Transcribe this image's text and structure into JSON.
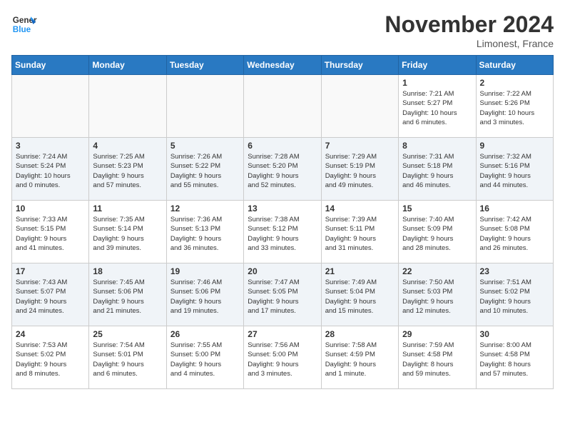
{
  "logo": {
    "line1": "General",
    "line2": "Blue"
  },
  "title": "November 2024",
  "location": "Limonest, France",
  "days_of_week": [
    "Sunday",
    "Monday",
    "Tuesday",
    "Wednesday",
    "Thursday",
    "Friday",
    "Saturday"
  ],
  "weeks": [
    [
      {
        "day": "",
        "info": ""
      },
      {
        "day": "",
        "info": ""
      },
      {
        "day": "",
        "info": ""
      },
      {
        "day": "",
        "info": ""
      },
      {
        "day": "",
        "info": ""
      },
      {
        "day": "1",
        "info": "Sunrise: 7:21 AM\nSunset: 5:27 PM\nDaylight: 10 hours\nand 6 minutes."
      },
      {
        "day": "2",
        "info": "Sunrise: 7:22 AM\nSunset: 5:26 PM\nDaylight: 10 hours\nand 3 minutes."
      }
    ],
    [
      {
        "day": "3",
        "info": "Sunrise: 7:24 AM\nSunset: 5:24 PM\nDaylight: 10 hours\nand 0 minutes."
      },
      {
        "day": "4",
        "info": "Sunrise: 7:25 AM\nSunset: 5:23 PM\nDaylight: 9 hours\nand 57 minutes."
      },
      {
        "day": "5",
        "info": "Sunrise: 7:26 AM\nSunset: 5:22 PM\nDaylight: 9 hours\nand 55 minutes."
      },
      {
        "day": "6",
        "info": "Sunrise: 7:28 AM\nSunset: 5:20 PM\nDaylight: 9 hours\nand 52 minutes."
      },
      {
        "day": "7",
        "info": "Sunrise: 7:29 AM\nSunset: 5:19 PM\nDaylight: 9 hours\nand 49 minutes."
      },
      {
        "day": "8",
        "info": "Sunrise: 7:31 AM\nSunset: 5:18 PM\nDaylight: 9 hours\nand 46 minutes."
      },
      {
        "day": "9",
        "info": "Sunrise: 7:32 AM\nSunset: 5:16 PM\nDaylight: 9 hours\nand 44 minutes."
      }
    ],
    [
      {
        "day": "10",
        "info": "Sunrise: 7:33 AM\nSunset: 5:15 PM\nDaylight: 9 hours\nand 41 minutes."
      },
      {
        "day": "11",
        "info": "Sunrise: 7:35 AM\nSunset: 5:14 PM\nDaylight: 9 hours\nand 39 minutes."
      },
      {
        "day": "12",
        "info": "Sunrise: 7:36 AM\nSunset: 5:13 PM\nDaylight: 9 hours\nand 36 minutes."
      },
      {
        "day": "13",
        "info": "Sunrise: 7:38 AM\nSunset: 5:12 PM\nDaylight: 9 hours\nand 33 minutes."
      },
      {
        "day": "14",
        "info": "Sunrise: 7:39 AM\nSunset: 5:11 PM\nDaylight: 9 hours\nand 31 minutes."
      },
      {
        "day": "15",
        "info": "Sunrise: 7:40 AM\nSunset: 5:09 PM\nDaylight: 9 hours\nand 28 minutes."
      },
      {
        "day": "16",
        "info": "Sunrise: 7:42 AM\nSunset: 5:08 PM\nDaylight: 9 hours\nand 26 minutes."
      }
    ],
    [
      {
        "day": "17",
        "info": "Sunrise: 7:43 AM\nSunset: 5:07 PM\nDaylight: 9 hours\nand 24 minutes."
      },
      {
        "day": "18",
        "info": "Sunrise: 7:45 AM\nSunset: 5:06 PM\nDaylight: 9 hours\nand 21 minutes."
      },
      {
        "day": "19",
        "info": "Sunrise: 7:46 AM\nSunset: 5:06 PM\nDaylight: 9 hours\nand 19 minutes."
      },
      {
        "day": "20",
        "info": "Sunrise: 7:47 AM\nSunset: 5:05 PM\nDaylight: 9 hours\nand 17 minutes."
      },
      {
        "day": "21",
        "info": "Sunrise: 7:49 AM\nSunset: 5:04 PM\nDaylight: 9 hours\nand 15 minutes."
      },
      {
        "day": "22",
        "info": "Sunrise: 7:50 AM\nSunset: 5:03 PM\nDaylight: 9 hours\nand 12 minutes."
      },
      {
        "day": "23",
        "info": "Sunrise: 7:51 AM\nSunset: 5:02 PM\nDaylight: 9 hours\nand 10 minutes."
      }
    ],
    [
      {
        "day": "24",
        "info": "Sunrise: 7:53 AM\nSunset: 5:02 PM\nDaylight: 9 hours\nand 8 minutes."
      },
      {
        "day": "25",
        "info": "Sunrise: 7:54 AM\nSunset: 5:01 PM\nDaylight: 9 hours\nand 6 minutes."
      },
      {
        "day": "26",
        "info": "Sunrise: 7:55 AM\nSunset: 5:00 PM\nDaylight: 9 hours\nand 4 minutes."
      },
      {
        "day": "27",
        "info": "Sunrise: 7:56 AM\nSunset: 5:00 PM\nDaylight: 9 hours\nand 3 minutes."
      },
      {
        "day": "28",
        "info": "Sunrise: 7:58 AM\nSunset: 4:59 PM\nDaylight: 9 hours\nand 1 minute."
      },
      {
        "day": "29",
        "info": "Sunrise: 7:59 AM\nSunset: 4:58 PM\nDaylight: 8 hours\nand 59 minutes."
      },
      {
        "day": "30",
        "info": "Sunrise: 8:00 AM\nSunset: 4:58 PM\nDaylight: 8 hours\nand 57 minutes."
      }
    ]
  ]
}
